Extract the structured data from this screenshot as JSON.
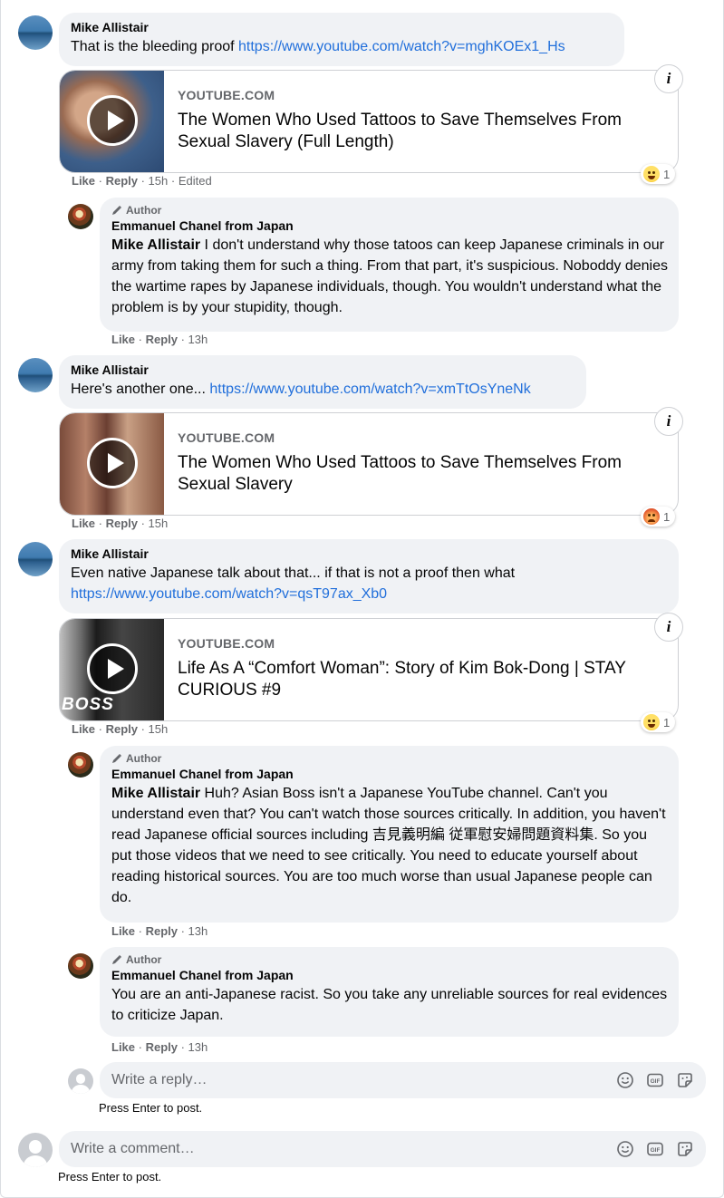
{
  "comments": [
    {
      "name": "Mike Allistair",
      "text": "That is the bleeding proof",
      "link": "https://www.youtube.com/watch?v=mghKOEx1_Hs",
      "card": {
        "source": "YOUTUBE.COM",
        "title": "The Women Who Used Tattoos to Save Themselves From Sexual Slavery (Full Length)"
      },
      "reaction": {
        "type": "haha-icon",
        "count": "1"
      },
      "actions": {
        "like": "Like",
        "reply": "Reply",
        "time": "15h",
        "edited": "Edited"
      }
    },
    {
      "badge": "Author",
      "name": "Emmanuel Chanel from Japan",
      "mention": "Mike Allistair",
      "text": " I don't understand why those tatoos can keep Japanese criminals in our army from taking them for such a thing. From that part, it's suspicious. Noboddy denies the wartime rapes by Japanese individuals, though. You wouldn't understand what the problem is by your stupidity, though.",
      "actions": {
        "like": "Like",
        "reply": "Reply",
        "time": "13h"
      }
    },
    {
      "name": "Mike Allistair",
      "text": "Here's another one...",
      "link": "https://www.youtube.com/watch?v=xmTtOsYneNk",
      "card": {
        "source": "YOUTUBE.COM",
        "title": "The Women Who Used Tattoos to Save Themselves From Sexual Slavery"
      },
      "reaction": {
        "type": "angry-icon",
        "count": "1"
      },
      "actions": {
        "like": "Like",
        "reply": "Reply",
        "time": "15h"
      }
    },
    {
      "name": "Mike Allistair",
      "text": "Even native Japanese talk about that... if that is not a proof then what",
      "link": "https://www.youtube.com/watch?v=qsT97ax_Xb0",
      "card": {
        "source": "YOUTUBE.COM",
        "title": "Life As A “Comfort Woman”: Story of Kim Bok-Dong | STAY CURIOUS #9",
        "thumb_text": "BOSS"
      },
      "reaction": {
        "type": "haha-icon",
        "count": "1"
      },
      "actions": {
        "like": "Like",
        "reply": "Reply",
        "time": "15h"
      }
    },
    {
      "badge": "Author",
      "name": "Emmanuel Chanel from Japan",
      "mention": "Mike Allistair",
      "text": " Huh? Asian Boss isn't a Japanese YouTube channel. Can't you understand even that? You can't watch those sources critically. In addition, you haven't read Japanese official sources including 吉見義明編 従軍慰安婦問題資料集. So you put those videos that we need to see critically. You need to educate yourself about reading historical sources. You are too much worse than usual Japanese people can do.",
      "actions": {
        "like": "Like",
        "reply": "Reply",
        "time": "13h"
      }
    },
    {
      "badge": "Author",
      "name": "Emmanuel Chanel from Japan",
      "text": "You are an anti-Japanese racist. So you take any unreliable sources for real evidences to criticize Japan.",
      "actions": {
        "like": "Like",
        "reply": "Reply",
        "time": "13h"
      }
    }
  ],
  "reply_box": {
    "placeholder": "Write a reply…",
    "hint": "Press Enter to post."
  },
  "comment_box": {
    "placeholder": "Write a comment…",
    "hint": "Press Enter to post."
  },
  "icons": [
    "emoji-icon",
    "gif-icon",
    "sticker-icon",
    "info-icon",
    "play-icon",
    "pen-icon"
  ]
}
